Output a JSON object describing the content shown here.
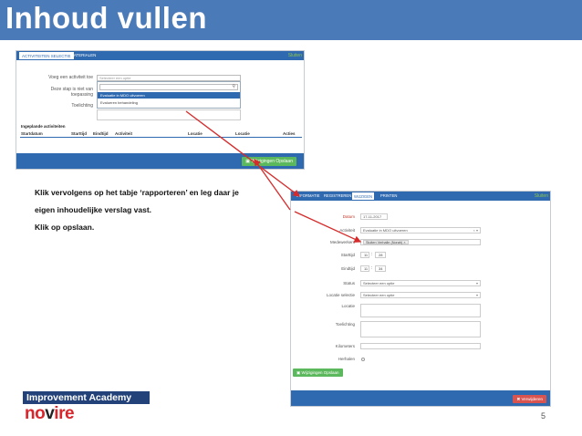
{
  "slide": {
    "title": "Inhoud vullen",
    "page_number": "5",
    "instructions": [
      "Klik vervolgens op het tabje ‘rapporteren’ en leg daar je",
      "eigen inhoudelijke verslag vast.",
      "Klik op opslaan."
    ]
  },
  "screenshot_1": {
    "tabs": [
      "ACTIVITEITEN SELECTIE",
      "MATERIALEN"
    ],
    "close_label": "Sluiten",
    "labels": [
      "Voeg een activiteit toe",
      "Deze stap is niet van toepassing",
      "Toelichting"
    ],
    "select_placeholder": "Selecteer een optie",
    "dropdown_options": [
      "Evaluatie in MDO uitvoeren",
      "Evalueren behandeling"
    ],
    "section_heading": "Ingeplande activiteiten",
    "columns": [
      "Startdatum",
      "Starttijd",
      "Eindtijd",
      "Activiteit",
      "Locatie",
      "Locatie",
      "Acties"
    ],
    "save_button": "Wijzigingen Opslaan"
  },
  "screenshot_2": {
    "tabs": [
      "INFORMATIE",
      "REGISTREREN",
      "WIJZIGEN",
      "PRINTEN"
    ],
    "close_label": "Sluiten",
    "fields": {
      "datum_label": "Datum",
      "datum_value": "17-11-2017",
      "activiteit_label": "Activiteit",
      "activiteit_value": "Evaluatie in MDO uitvoeren",
      "medewerkers_label": "Medewerkers",
      "medewerkers_tag": "Sluiten Verhalle (Norah)",
      "starttijd_label": "Starttijd",
      "start_hour": "11",
      "start_minute": "28",
      "eindtijd_label": "Eindtijd",
      "end_hour": "11",
      "end_minute": "34",
      "status_label": "Status",
      "status_placeholder": "Selecteer een optie",
      "locatie_selectie_label": "Locatie selectie",
      "locatie_selectie_placeholder": "Selecteer een optie",
      "locatie_label": "Locatie",
      "toelichting_label": "Toelichting",
      "kilometers_label": "Kilometers",
      "herhalen_label": "Herhalen"
    },
    "save_button": "Wijzigingen Opslaan",
    "delete_button": "Verwijderen"
  },
  "logo": {
    "band_text": "Improvement Academy",
    "word_prefix": "no",
    "word_v": "v",
    "word_suffix": "ire"
  },
  "colors": {
    "title_bar": "#4a7ab8",
    "app_blue": "#2f6ab0",
    "green_button": "#5cb85c",
    "red_button": "#d9534f",
    "arrow_red": "#d62b2b",
    "logo_navy": "#23427a",
    "logo_red": "#d8262c"
  }
}
